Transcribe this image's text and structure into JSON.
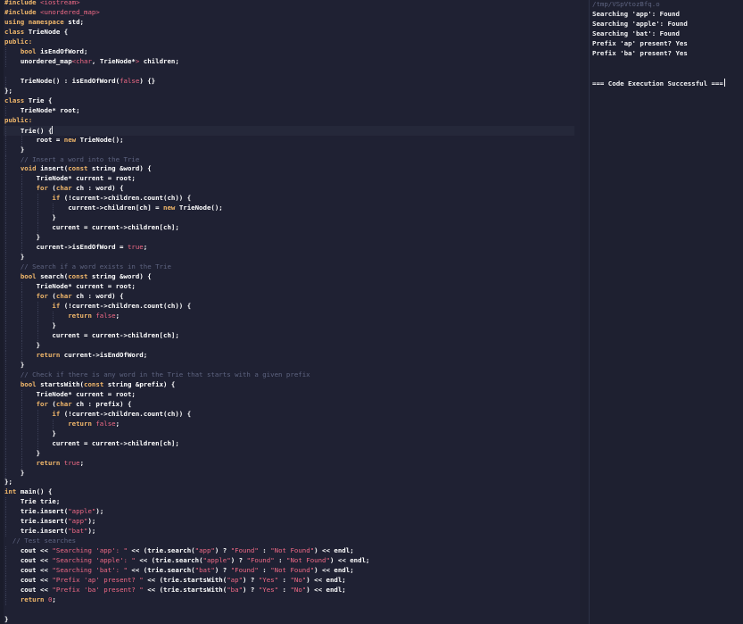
{
  "editor": {
    "lines": [
      [
        [
          "pp",
          "#include "
        ],
        [
          "str",
          "<iostream>"
        ]
      ],
      [
        [
          "pp",
          "#include "
        ],
        [
          "str",
          "<unordered_map>"
        ]
      ],
      [
        [
          "kw",
          "using namespace "
        ],
        [
          "id",
          "std;"
        ]
      ],
      [
        [
          "kw",
          "class "
        ],
        [
          "id",
          "TrieNode {"
        ]
      ],
      [
        [
          "kw",
          "public:"
        ]
      ],
      [
        [
          "txt",
          "    "
        ],
        [
          "kw",
          "bool "
        ],
        [
          "id",
          "isEndOfWord;"
        ]
      ],
      [
        [
          "txt",
          "    "
        ],
        [
          "id",
          "unordered_map"
        ],
        [
          "str",
          "<char"
        ],
        [
          "id",
          ", TrieNode*"
        ],
        [
          "str",
          ">"
        ],
        [
          "id",
          " children;"
        ]
      ],
      [],
      [
        [
          "txt",
          "    "
        ],
        [
          "id",
          "TrieNode() : isEndOfWord("
        ],
        [
          "num",
          "false"
        ],
        [
          "id",
          ") {}"
        ]
      ],
      [
        [
          "id",
          "};"
        ]
      ],
      [
        [
          "kw",
          "class "
        ],
        [
          "id",
          "Trie {"
        ]
      ],
      [
        [
          "txt",
          "    "
        ],
        [
          "id",
          "TrieNode* root;"
        ]
      ],
      [
        [
          "kw",
          "public:"
        ]
      ],
      [
        [
          "txt",
          "    "
        ],
        [
          "id",
          "Trie() {"
        ],
        [
          "caret",
          ""
        ]
      ],
      [
        [
          "txt",
          "        "
        ],
        [
          "id",
          "root = "
        ],
        [
          "kw",
          "new "
        ],
        [
          "id",
          "TrieNode();"
        ]
      ],
      [
        [
          "txt",
          "    "
        ],
        [
          "id",
          "}"
        ]
      ],
      [
        [
          "txt",
          "    "
        ],
        [
          "cmt",
          "// Insert a word into the Trie"
        ]
      ],
      [
        [
          "txt",
          "    "
        ],
        [
          "kw",
          "void "
        ],
        [
          "id",
          "insert("
        ],
        [
          "kw",
          "const "
        ],
        [
          "id",
          "string &word) {"
        ]
      ],
      [
        [
          "txt",
          "        "
        ],
        [
          "id",
          "TrieNode* current = root;"
        ]
      ],
      [
        [
          "txt",
          "        "
        ],
        [
          "kw",
          "for "
        ],
        [
          "id",
          "("
        ],
        [
          "kw",
          "char "
        ],
        [
          "id",
          "ch : word) {"
        ]
      ],
      [
        [
          "txt",
          "            "
        ],
        [
          "kw",
          "if "
        ],
        [
          "id",
          "(!current->children.count(ch)) {"
        ]
      ],
      [
        [
          "txt",
          "                "
        ],
        [
          "id",
          "current->children[ch] = "
        ],
        [
          "kw",
          "new "
        ],
        [
          "id",
          "TrieNode();"
        ]
      ],
      [
        [
          "txt",
          "            "
        ],
        [
          "id",
          "}"
        ]
      ],
      [
        [
          "txt",
          "            "
        ],
        [
          "id",
          "current = current->children[ch];"
        ]
      ],
      [
        [
          "txt",
          "        "
        ],
        [
          "id",
          "}"
        ]
      ],
      [
        [
          "txt",
          "        "
        ],
        [
          "id",
          "current->isEndOfWord = "
        ],
        [
          "num",
          "true"
        ],
        [
          "id",
          ";"
        ]
      ],
      [
        [
          "txt",
          "    "
        ],
        [
          "id",
          "}"
        ]
      ],
      [
        [
          "txt",
          "    "
        ],
        [
          "cmt",
          "// Search if a word exists in the Trie"
        ]
      ],
      [
        [
          "txt",
          "    "
        ],
        [
          "kw",
          "bool "
        ],
        [
          "id",
          "search("
        ],
        [
          "kw",
          "const "
        ],
        [
          "id",
          "string &word) {"
        ]
      ],
      [
        [
          "txt",
          "        "
        ],
        [
          "id",
          "TrieNode* current = root;"
        ]
      ],
      [
        [
          "txt",
          "        "
        ],
        [
          "kw",
          "for "
        ],
        [
          "id",
          "("
        ],
        [
          "kw",
          "char "
        ],
        [
          "id",
          "ch : word) {"
        ]
      ],
      [
        [
          "txt",
          "            "
        ],
        [
          "kw",
          "if "
        ],
        [
          "id",
          "(!current->children.count(ch)) {"
        ]
      ],
      [
        [
          "txt",
          "                "
        ],
        [
          "kw",
          "return "
        ],
        [
          "num",
          "false"
        ],
        [
          "id",
          ";"
        ]
      ],
      [
        [
          "txt",
          "            "
        ],
        [
          "id",
          "}"
        ]
      ],
      [
        [
          "txt",
          "            "
        ],
        [
          "id",
          "current = current->children[ch];"
        ]
      ],
      [
        [
          "txt",
          "        "
        ],
        [
          "id",
          "}"
        ]
      ],
      [
        [
          "txt",
          "        "
        ],
        [
          "kw",
          "return "
        ],
        [
          "id",
          "current->isEndOfWord;"
        ]
      ],
      [
        [
          "txt",
          "    "
        ],
        [
          "id",
          "}"
        ]
      ],
      [
        [
          "txt",
          "    "
        ],
        [
          "cmt",
          "// Check if there is any word in the Trie that starts with a given prefix"
        ]
      ],
      [
        [
          "txt",
          "    "
        ],
        [
          "kw",
          "bool "
        ],
        [
          "id",
          "startsWith("
        ],
        [
          "kw",
          "const "
        ],
        [
          "id",
          "string &prefix) {"
        ]
      ],
      [
        [
          "txt",
          "        "
        ],
        [
          "id",
          "TrieNode* current = root;"
        ]
      ],
      [
        [
          "txt",
          "        "
        ],
        [
          "kw",
          "for "
        ],
        [
          "id",
          "("
        ],
        [
          "kw",
          "char "
        ],
        [
          "id",
          "ch : prefix) {"
        ]
      ],
      [
        [
          "txt",
          "            "
        ],
        [
          "kw",
          "if "
        ],
        [
          "id",
          "(!current->children.count(ch)) {"
        ]
      ],
      [
        [
          "txt",
          "                "
        ],
        [
          "kw",
          "return "
        ],
        [
          "num",
          "false"
        ],
        [
          "id",
          ";"
        ]
      ],
      [
        [
          "txt",
          "            "
        ],
        [
          "id",
          "}"
        ]
      ],
      [
        [
          "txt",
          "            "
        ],
        [
          "id",
          "current = current->children[ch];"
        ]
      ],
      [
        [
          "txt",
          "        "
        ],
        [
          "id",
          "}"
        ]
      ],
      [
        [
          "txt",
          "        "
        ],
        [
          "kw",
          "return "
        ],
        [
          "num",
          "true"
        ],
        [
          "id",
          ";"
        ]
      ],
      [
        [
          "txt",
          "    "
        ],
        [
          "id",
          "}"
        ]
      ],
      [
        [
          "id",
          "};"
        ]
      ],
      [
        [
          "kw",
          "int "
        ],
        [
          "id",
          "main() {"
        ]
      ],
      [
        [
          "txt",
          "    "
        ],
        [
          "id",
          "Trie trie;"
        ]
      ],
      [
        [
          "txt",
          "    "
        ],
        [
          "id",
          "trie.insert("
        ],
        [
          "str",
          "\"apple\""
        ],
        [
          "id",
          ");"
        ]
      ],
      [
        [
          "txt",
          "    "
        ],
        [
          "id",
          "trie.insert("
        ],
        [
          "str",
          "\"app\""
        ],
        [
          "id",
          ");"
        ]
      ],
      [
        [
          "txt",
          "    "
        ],
        [
          "id",
          "trie.insert("
        ],
        [
          "str",
          "\"bat\""
        ],
        [
          "id",
          ");"
        ]
      ],
      [
        [
          "txt",
          "  "
        ],
        [
          "cmt",
          "// Test searches"
        ]
      ],
      [
        [
          "txt",
          "    "
        ],
        [
          "id",
          "cout << "
        ],
        [
          "str",
          "\"Searching 'app': \""
        ],
        [
          "id",
          " << (trie.search("
        ],
        [
          "str",
          "\"app\""
        ],
        [
          "id",
          ") ? "
        ],
        [
          "str",
          "\"Found\""
        ],
        [
          "id",
          " : "
        ],
        [
          "str",
          "\"Not Found\""
        ],
        [
          "id",
          ") << endl;"
        ]
      ],
      [
        [
          "txt",
          "    "
        ],
        [
          "id",
          "cout << "
        ],
        [
          "str",
          "\"Searching 'apple': \""
        ],
        [
          "id",
          " << (trie.search("
        ],
        [
          "str",
          "\"apple\""
        ],
        [
          "id",
          ") ? "
        ],
        [
          "str",
          "\"Found\""
        ],
        [
          "id",
          " : "
        ],
        [
          "str",
          "\"Not Found\""
        ],
        [
          "id",
          ") << endl;"
        ]
      ],
      [
        [
          "txt",
          "    "
        ],
        [
          "id",
          "cout << "
        ],
        [
          "str",
          "\"Searching 'bat': \""
        ],
        [
          "id",
          " << (trie.search("
        ],
        [
          "str",
          "\"bat\""
        ],
        [
          "id",
          ") ? "
        ],
        [
          "str",
          "\"Found\""
        ],
        [
          "id",
          " : "
        ],
        [
          "str",
          "\"Not Found\""
        ],
        [
          "id",
          ") << endl;"
        ]
      ],
      [
        [
          "txt",
          "    "
        ],
        [
          "id",
          "cout << "
        ],
        [
          "str",
          "\"Prefix 'ap' present? \""
        ],
        [
          "id",
          " << (trie.startsWith("
        ],
        [
          "str",
          "\"ap\""
        ],
        [
          "id",
          ") ? "
        ],
        [
          "str",
          "\"Yes\""
        ],
        [
          "id",
          " : "
        ],
        [
          "str",
          "\"No\""
        ],
        [
          "id",
          ") << endl;"
        ]
      ],
      [
        [
          "txt",
          "    "
        ],
        [
          "id",
          "cout << "
        ],
        [
          "str",
          "\"Prefix 'ba' present? \""
        ],
        [
          "id",
          " << (trie.startsWith("
        ],
        [
          "str",
          "\"ba\""
        ],
        [
          "id",
          ") ? "
        ],
        [
          "str",
          "\"Yes\""
        ],
        [
          "id",
          " : "
        ],
        [
          "str",
          "\"No\""
        ],
        [
          "id",
          ") << endl;"
        ]
      ],
      [
        [
          "txt",
          "    "
        ],
        [
          "kw",
          "return "
        ],
        [
          "num",
          "0"
        ],
        [
          "id",
          ";"
        ]
      ],
      [],
      [
        [
          "id",
          "}"
        ]
      ]
    ],
    "current_line": 13
  },
  "output": {
    "path": "/tmp/VSpVtozBfq.o",
    "lines": [
      "Searching 'app': Found",
      "Searching 'apple': Found",
      "Searching 'bat': Found",
      "Prefix 'ap' present? Yes",
      "Prefix 'ba' present? Yes",
      "",
      "",
      "=== Code Execution Successful ==="
    ]
  }
}
